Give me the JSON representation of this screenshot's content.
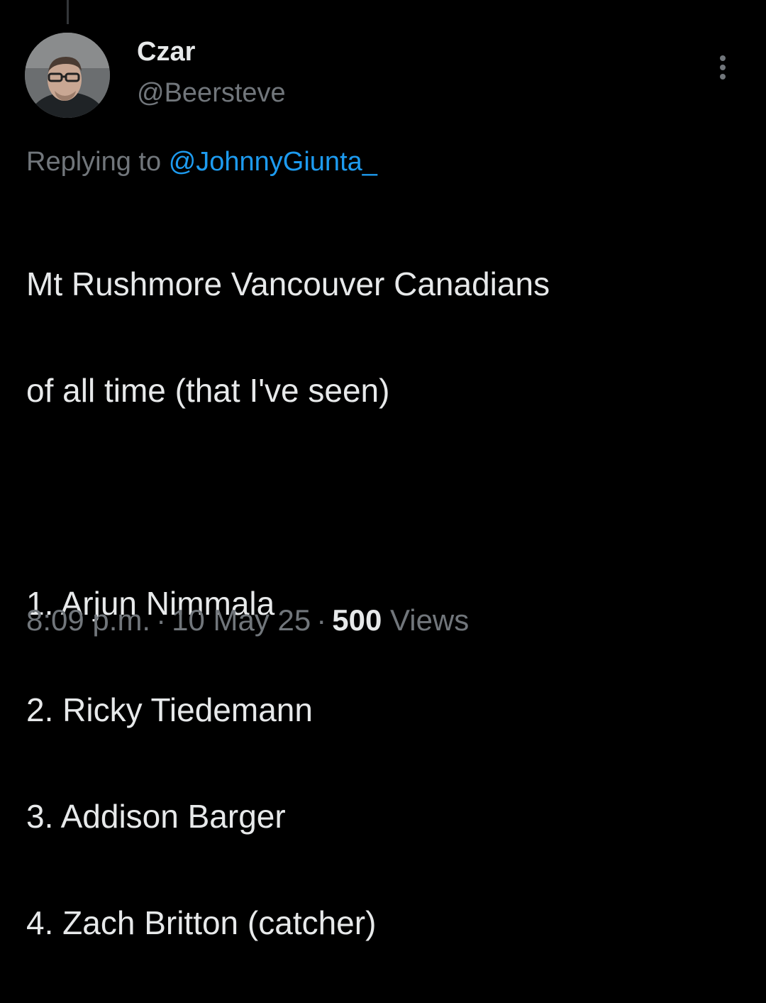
{
  "tweet": {
    "author": {
      "display_name": "Czar",
      "handle": "@Beersteve"
    },
    "reply_prefix": "Replying to",
    "reply_to": "@JohnnyGiunta_",
    "text_lines": [
      "Mt Rushmore Vancouver Canadians",
      "of all time (that I've seen)",
      "",
      "1. Arjun Nimmala",
      "2. Ricky Tiedemann",
      "3. Addison Barger",
      "4. Zach Britton (catcher)"
    ],
    "time": "8:09 p.m.",
    "date": "10 May 25",
    "separator": "·",
    "views_count": "500",
    "views_label": "Views"
  },
  "icons": {
    "more": "more-vertical-icon"
  },
  "colors": {
    "background": "#000000",
    "primary_text": "#e7e9ea",
    "secondary_text": "#71767b",
    "accent": "#1d9bf0"
  }
}
